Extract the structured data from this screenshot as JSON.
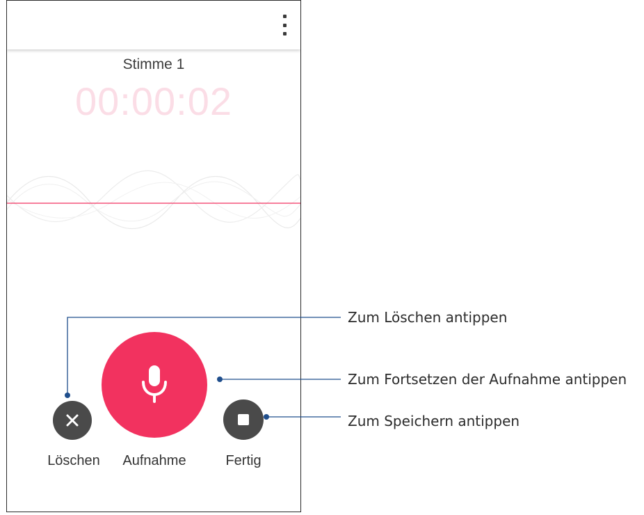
{
  "app": {
    "title": "Stimme 1",
    "timer": "00:00:02",
    "overflow_icon": "more-vert-icon",
    "accent_color": "#f2325f"
  },
  "controls": {
    "delete": {
      "label": "Löschen",
      "icon": "close-icon"
    },
    "record": {
      "label": "Aufnahme",
      "icon": "microphone-icon"
    },
    "done": {
      "label": "Fertig",
      "icon": "stop-icon"
    }
  },
  "callouts": {
    "delete": "Zum Löschen antippen",
    "record": "Zum Fortsetzen der Aufnahme antippen",
    "done": "Zum Speichern antippen"
  }
}
